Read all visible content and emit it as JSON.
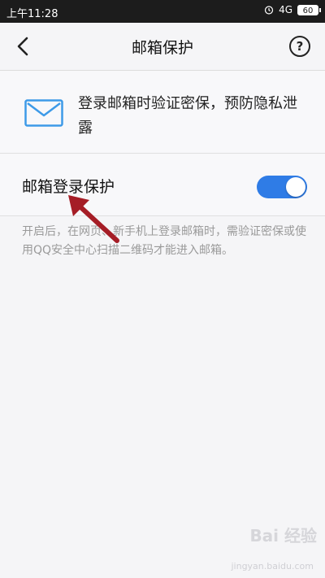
{
  "status_bar": {
    "time": "上午11:28",
    "signal": "4G",
    "battery": "60"
  },
  "header": {
    "title": "邮箱保护",
    "help_label": "?"
  },
  "intro": {
    "text": "登录邮箱时验证密保，预防隐私泄露"
  },
  "protection": {
    "label": "邮箱登录保护",
    "enabled": true
  },
  "description": "开启后，在网页、新手机上登录邮箱时，需验证密保或使用QQ安全中心扫描二维码才能进入邮箱。",
  "watermark": {
    "logo": "Bai 经验",
    "sub": "jingyan.baidu.com"
  },
  "colors": {
    "accent": "#2f7ce6",
    "annotation_arrow": "#a51d26"
  }
}
